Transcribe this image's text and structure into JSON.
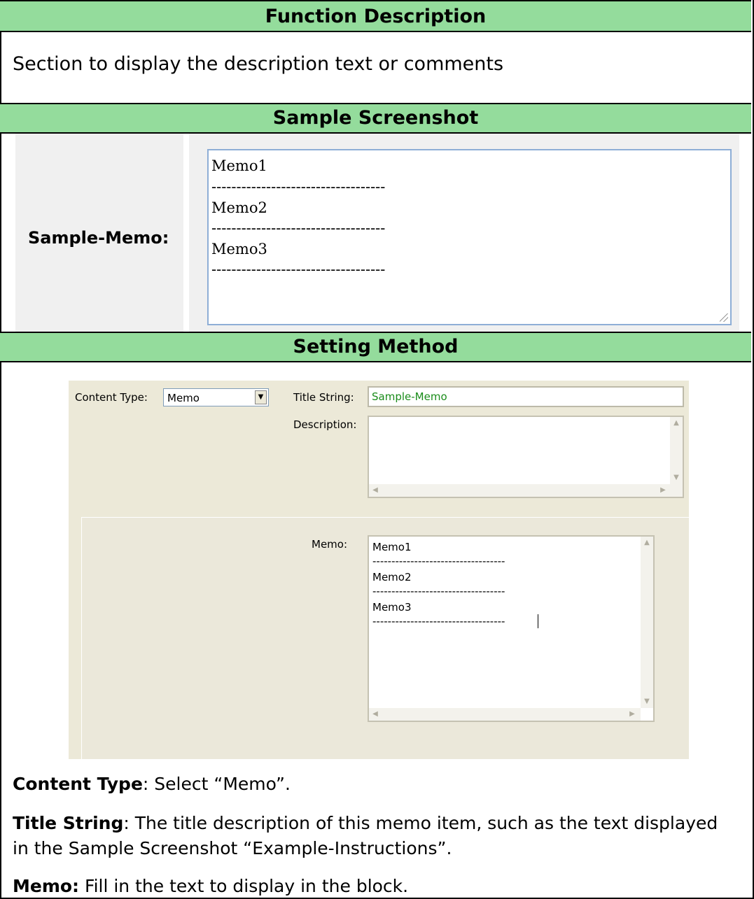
{
  "headers": {
    "function_description": "Function Description",
    "sample_screenshot": "Sample Screenshot",
    "setting_method": "Setting Method"
  },
  "function_description_text": "Section to display the description text or comments",
  "sample": {
    "label": "Sample-Memo:",
    "lines": [
      "Memo1",
      "-----------------------------------",
      "Memo2",
      "-----------------------------------",
      "Memo3",
      "-----------------------------------"
    ]
  },
  "settings": {
    "content_type_label": "Content Type:",
    "content_type_value": "Memo",
    "title_string_label": "Title String:",
    "title_string_value": "Sample-Memo",
    "description_label": "Description:",
    "description_value": "",
    "memo_label": "Memo:",
    "memo_lines": [
      "Memo1",
      "-----------------------------------",
      "Memo2",
      "-----------------------------------",
      "Memo3",
      "-----------------------------------"
    ]
  },
  "notes": {
    "content_type": {
      "term": "Content Type",
      "text": ": Select “Memo”."
    },
    "title_string": {
      "term": "Title String",
      "text": ": The title description of this memo item, such as the text displayed",
      "text2": "in the Sample Screenshot “Example-Instructions”."
    },
    "memo": {
      "term": "Memo:",
      "text": " Fill in the text to display in the block."
    }
  },
  "colors": {
    "header_green": "#94dc9c",
    "panel_beige": "#ece9d8",
    "title_value_green": "#1a8c1a",
    "memo_border_blue": "#8eaed6"
  }
}
